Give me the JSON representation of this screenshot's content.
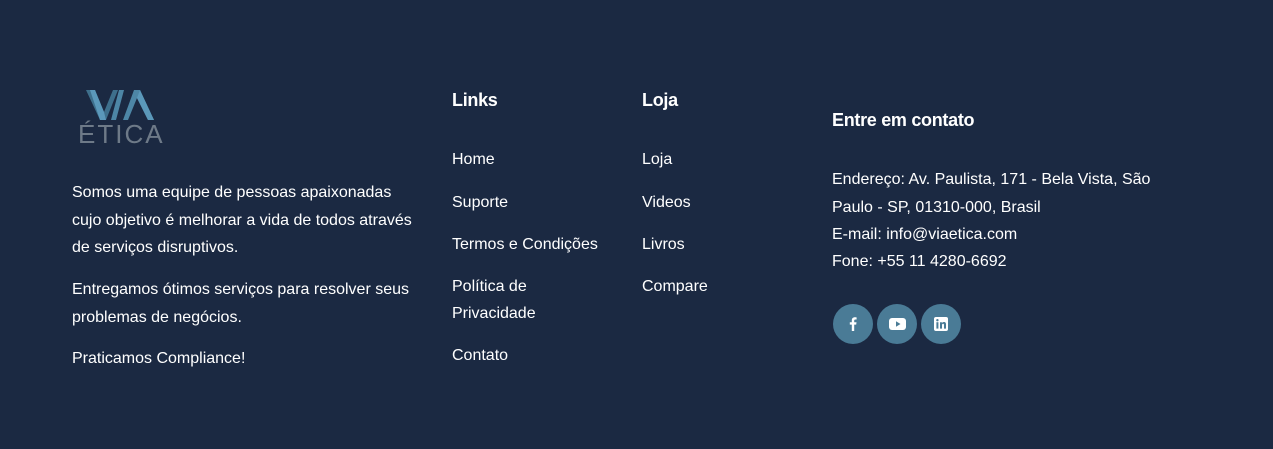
{
  "brand": {
    "logo_top": "VIA",
    "logo_bottom": "ÉTICA",
    "colors": {
      "logo_top": "#4d86a6",
      "logo_bottom": "#6e7a88",
      "background": "#1b2942",
      "social": "#4a7b96"
    }
  },
  "about": {
    "paragraphs": [
      "Somos uma equipe de pessoas apaixonadas cujo objetivo é melhorar a vida de todos através de serviços disruptivos.",
      "Entregamos ótimos serviços para resolver seus problemas de negócios.",
      "Praticamos Compliance!"
    ]
  },
  "links": {
    "heading": "Links",
    "items": [
      "Home",
      "Suporte",
      "Termos e Condições",
      "Política de Privacidade",
      "Contato"
    ]
  },
  "shop": {
    "heading": "Loja",
    "items": [
      "Loja",
      "Videos",
      "Livros",
      "Compare"
    ]
  },
  "contact": {
    "heading": "Entre em contato",
    "address_line1": "Endereço: Av. Paulista, 171 - Bela Vista, São",
    "address_line2": "Paulo - SP, 01310-000, Brasil",
    "email": "E-mail: info@viaetica.com",
    "phone": "Fone: +55 11 4280-6692"
  },
  "social": [
    {
      "icon": "facebook-icon",
      "glyph": "f"
    },
    {
      "icon": "youtube-icon",
      "glyph": "▶"
    },
    {
      "icon": "linkedin-icon",
      "glyph": "in"
    }
  ]
}
